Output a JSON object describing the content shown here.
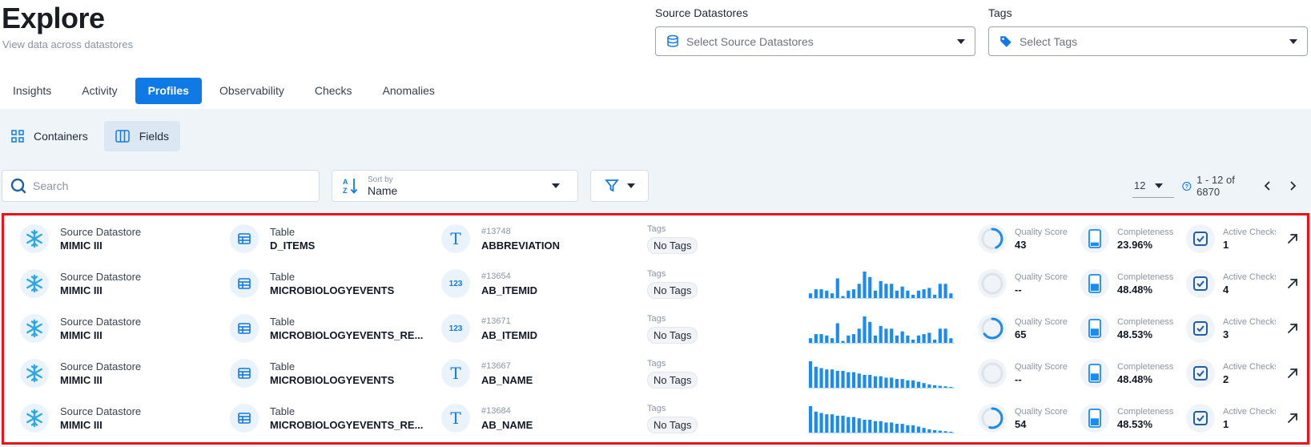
{
  "header": {
    "title": "Explore",
    "subtitle": "View data across datastores"
  },
  "filters": {
    "datastores": {
      "label": "Source Datastores",
      "placeholder": "Select Source Datastores"
    },
    "tags": {
      "label": "Tags",
      "placeholder": "Select Tags"
    }
  },
  "tabs": [
    {
      "label": "Insights",
      "active": false
    },
    {
      "label": "Activity",
      "active": false
    },
    {
      "label": "Profiles",
      "active": true
    },
    {
      "label": "Observability",
      "active": false
    },
    {
      "label": "Checks",
      "active": false
    },
    {
      "label": "Anomalies",
      "active": false
    }
  ],
  "view_toggle": {
    "containers": "Containers",
    "fields": "Fields",
    "active": "fields"
  },
  "toolbar": {
    "search_placeholder": "Search",
    "sort_label": "Sort by",
    "sort_value": "Name"
  },
  "pager": {
    "page_size": "12",
    "range": "1 - 12 of 6870"
  },
  "colors": {
    "accent": "#0f7ae5",
    "highlight_border": "#e5141a",
    "bar": "#1a8cf0"
  },
  "rows": [
    {
      "datastore_label": "Source Datastore",
      "datastore": "MIMIC III",
      "container_label": "Table",
      "container": "D_ITEMS",
      "type_icon": "text-type-icon",
      "type_glyph": "T",
      "field_id": "#13748",
      "field": "ABBREVIATION",
      "tags_label": "Tags",
      "tags": "No Tags",
      "histogram": [],
      "quality_label": "Quality Score",
      "quality": "43",
      "quality_fraction": 0.43,
      "completeness_label": "Completeness",
      "completeness": "23.96%",
      "completeness_fraction": 0.2396,
      "checks_label": "Active Checks",
      "checks": "1"
    },
    {
      "datastore_label": "Source Datastore",
      "datastore": "MIMIC III",
      "container_label": "Table",
      "container": "MICROBIOLOGYEVENTS",
      "type_icon": "numeric-type-icon",
      "type_glyph": "123",
      "field_id": "#13654",
      "field": "AB_ITEMID",
      "tags_label": "Tags",
      "tags": "No Tags",
      "histogram": [
        0.2,
        0.35,
        0.35,
        0.3,
        0.2,
        0.75,
        0.1,
        0.3,
        0.35,
        0.55,
        1.0,
        0.8,
        0.3,
        0.65,
        0.55,
        0.55,
        0.3,
        0.45,
        0.3,
        0.15,
        0.3,
        0.35,
        0.4,
        0.15,
        0.55,
        0.55,
        0.2
      ],
      "quality_label": "Quality Score",
      "quality": "--",
      "quality_fraction": 0,
      "completeness_label": "Completeness",
      "completeness": "48.48%",
      "completeness_fraction": 0.4848,
      "checks_label": "Active Checks",
      "checks": "4"
    },
    {
      "datastore_label": "Source Datastore",
      "datastore": "MIMIC III",
      "container_label": "Table",
      "container": "MICROBIOLOGYEVENTS_RE...",
      "type_icon": "numeric-type-icon",
      "type_glyph": "123",
      "field_id": "#13671",
      "field": "AB_ITEMID",
      "tags_label": "Tags",
      "tags": "No Tags",
      "histogram": [
        0.2,
        0.35,
        0.35,
        0.3,
        0.2,
        0.75,
        0.1,
        0.3,
        0.35,
        0.55,
        1.0,
        0.8,
        0.3,
        0.65,
        0.55,
        0.55,
        0.3,
        0.45,
        0.3,
        0.15,
        0.3,
        0.35,
        0.4,
        0.15,
        0.55,
        0.55,
        0.2
      ],
      "quality_label": "Quality Score",
      "quality": "65",
      "quality_fraction": 0.65,
      "completeness_label": "Completeness",
      "completeness": "48.53%",
      "completeness_fraction": 0.4853,
      "checks_label": "Active Checks",
      "checks": "3"
    },
    {
      "datastore_label": "Source Datastore",
      "datastore": "MIMIC III",
      "container_label": "Table",
      "container": "MICROBIOLOGYEVENTS",
      "type_icon": "text-type-icon",
      "type_glyph": "T",
      "field_id": "#13667",
      "field": "AB_NAME",
      "tags_label": "Tags",
      "tags": "No Tags",
      "histogram": [
        1.0,
        0.8,
        0.75,
        0.7,
        0.7,
        0.65,
        0.65,
        0.6,
        0.6,
        0.55,
        0.5,
        0.5,
        0.45,
        0.45,
        0.4,
        0.4,
        0.35,
        0.35,
        0.3,
        0.3,
        0.25,
        0.2,
        0.15,
        0.12,
        0.1,
        0.08,
        0.06
      ],
      "quality_label": "Quality Score",
      "quality": "--",
      "quality_fraction": 0,
      "completeness_label": "Completeness",
      "completeness": "48.48%",
      "completeness_fraction": 0.4848,
      "checks_label": "Active Checks",
      "checks": "2"
    },
    {
      "datastore_label": "Source Datastore",
      "datastore": "MIMIC III",
      "container_label": "Table",
      "container": "MICROBIOLOGYEVENTS_RE...",
      "type_icon": "text-type-icon",
      "type_glyph": "T",
      "field_id": "#13684",
      "field": "AB_NAME",
      "tags_label": "Tags",
      "tags": "No Tags",
      "histogram": [
        1.0,
        0.8,
        0.75,
        0.7,
        0.7,
        0.65,
        0.65,
        0.6,
        0.6,
        0.55,
        0.5,
        0.5,
        0.45,
        0.45,
        0.4,
        0.4,
        0.35,
        0.35,
        0.3,
        0.3,
        0.25,
        0.2,
        0.15,
        0.12,
        0.1,
        0.08,
        0.06
      ],
      "quality_label": "Quality Score",
      "quality": "54",
      "quality_fraction": 0.54,
      "completeness_label": "Completeness",
      "completeness": "48.53%",
      "completeness_fraction": 0.4853,
      "checks_label": "Active Checks",
      "checks": "1"
    }
  ]
}
